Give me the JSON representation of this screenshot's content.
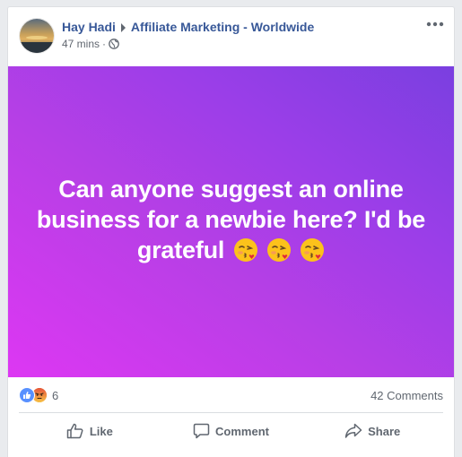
{
  "post": {
    "author": "Hay Hadi",
    "group": "Affiliate Marketing - Worldwide",
    "time": "47 mins",
    "privacy_icon": "globe-icon",
    "menu_icon": "more-options-icon",
    "text": "Can anyone suggest an online business for a newbie here? I'd be grateful",
    "emoji": [
      "kissing-heart-emoji",
      "kissing-heart-emoji",
      "kissing-heart-emoji"
    ],
    "background_colors": [
      "#dd37f3",
      "#7a3fe0"
    ]
  },
  "stats": {
    "reaction_icons": [
      "like-reaction-icon",
      "angry-reaction-icon"
    ],
    "reaction_count": "6",
    "comments": "42 Comments"
  },
  "actions": {
    "like": "Like",
    "comment": "Comment",
    "share": "Share"
  },
  "colors": {
    "link": "#385898",
    "secondary_text": "#606770"
  }
}
